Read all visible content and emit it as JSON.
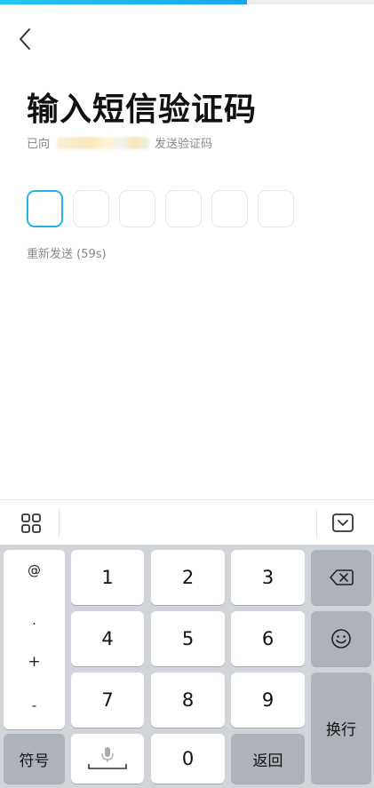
{
  "header": {
    "progress": 0.66
  },
  "main": {
    "title": "输入短信验证码",
    "subtitle_prefix": "已向",
    "subtitle_suffix": "发送验证码",
    "code_length": 6,
    "resend_label": "重新发送 (59s)"
  },
  "keyboard": {
    "toolbar": {
      "grid_icon": "grid-apps-icon",
      "hide_icon": "keyboard-hide-icon"
    },
    "symbols": [
      "@",
      ".",
      "+",
      "-"
    ],
    "digits": [
      "1",
      "2",
      "3",
      "4",
      "5",
      "6",
      "7",
      "8",
      "9",
      "0"
    ],
    "symbols_key": "符号",
    "return_key": "返回",
    "newline_key": "换行",
    "backspace_icon": "backspace-icon",
    "emoji_icon": "emoji-smile-icon",
    "space_icon": "microphone-space-icon"
  },
  "colors": {
    "accent": "#2ab3e6",
    "keyboard_bg": "#d1d4d9",
    "function_key": "#aeb3bb"
  }
}
